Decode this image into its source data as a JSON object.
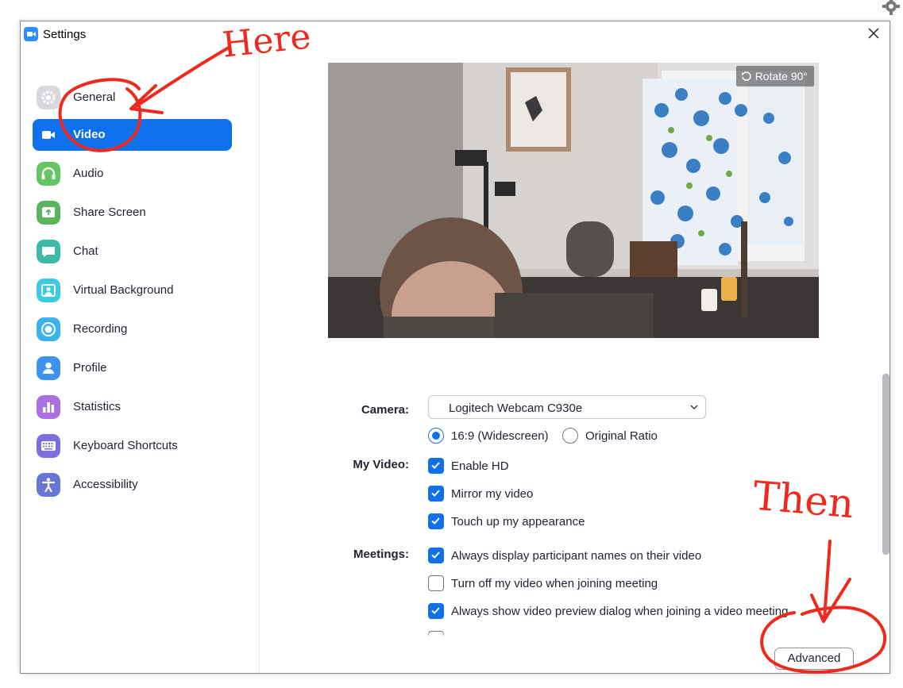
{
  "window": {
    "title": "Settings"
  },
  "sidebar": {
    "items": [
      {
        "label": "General",
        "icon": "gear-icon",
        "color": "#d9d9dd",
        "active": false
      },
      {
        "label": "Video",
        "icon": "video-camera-icon",
        "color": "#0e71eb",
        "active": true
      },
      {
        "label": "Audio",
        "icon": "headphones-icon",
        "color": "#65c466",
        "active": false
      },
      {
        "label": "Share Screen",
        "icon": "share-screen-icon",
        "color": "#5ab55e",
        "active": false
      },
      {
        "label": "Chat",
        "icon": "chat-bubble-icon",
        "color": "#3cbca8",
        "active": false
      },
      {
        "label": "Virtual Background",
        "icon": "portrait-icon",
        "color": "#3ccbe0",
        "active": false
      },
      {
        "label": "Recording",
        "icon": "record-icon",
        "color": "#3cb2ee",
        "active": false
      },
      {
        "label": "Profile",
        "icon": "person-icon",
        "color": "#3d92ee",
        "active": false
      },
      {
        "label": "Statistics",
        "icon": "bar-chart-icon",
        "color": "#a870e0",
        "active": false
      },
      {
        "label": "Keyboard Shortcuts",
        "icon": "keyboard-icon",
        "color": "#7b6fe0",
        "active": false
      },
      {
        "label": "Accessibility",
        "icon": "accessibility-icon",
        "color": "#6876d8",
        "active": false
      }
    ]
  },
  "video": {
    "rotate_label": "Rotate 90°",
    "camera_label": "Camera:",
    "camera_value": "Logitech Webcam C930e",
    "ratio_options": [
      {
        "label": "16:9 (Widescreen)",
        "checked": true
      },
      {
        "label": "Original Ratio",
        "checked": false
      }
    ],
    "my_video_label": "My Video:",
    "my_video_options": [
      {
        "label": "Enable HD",
        "checked": true
      },
      {
        "label": "Mirror my video",
        "checked": true
      },
      {
        "label": "Touch up my appearance",
        "checked": true
      }
    ],
    "meetings_label": "Meetings:",
    "meetings_options": [
      {
        "label": "Always display participant names on their video",
        "checked": true
      },
      {
        "label": "Turn off my video when joining meeting",
        "checked": false
      },
      {
        "label": "Always show video preview dialog when joining a video meeting",
        "checked": true
      }
    ],
    "advanced_label": "Advanced"
  },
  "annotations": {
    "here_text": "Here",
    "then_text": "Then",
    "color": "#ee2a1f"
  },
  "colors": {
    "accent": "#0e71eb",
    "text": "#232333"
  }
}
